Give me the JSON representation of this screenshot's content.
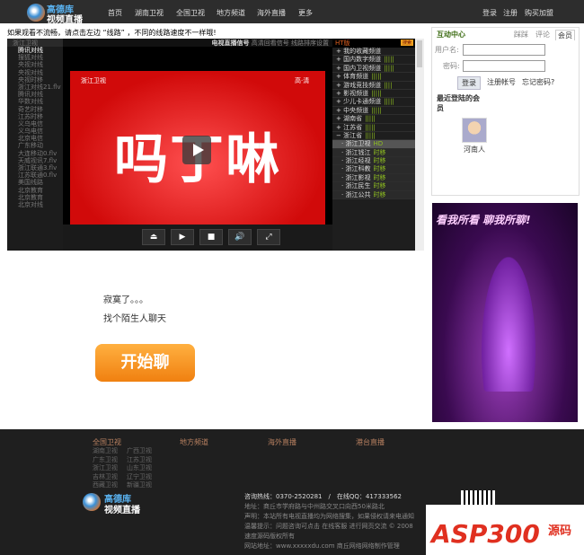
{
  "header": {
    "logo_line1": "高德库",
    "logo_line2": "视频直播",
    "nav": [
      "首页",
      "湖南卫视",
      "全国卫视",
      "地方频道",
      "海外直播",
      "更多"
    ],
    "user_links": [
      "登录",
      "注册",
      "购买加盟"
    ]
  },
  "notice": "如果观看不流畅，请点击左边 “线路” ，不同的线路速度不一样哦!",
  "player": {
    "left_head": "浙江卫视",
    "lines": [
      "腾讯对线",
      "搜狐对线",
      "央视对线",
      "央视对线",
      "央视时移",
      "浙江对线21.flv",
      "腾讯对线",
      "华数对线",
      "奇艺时移",
      "江苏时移",
      "义乌电信",
      "义乌电信",
      "北京电信",
      "广东移动",
      "大连移动0.flv",
      "天威视讯7.flv",
      "浙江联通3.flv",
      "江苏联通0.flv",
      "美国线路",
      "北京教育",
      "北京教育",
      "北京对线"
    ],
    "topbar_bold": "电视直播信号",
    "topbar_links": "高清回看信号 线路排序设置",
    "video_text": "吗丁啉",
    "channel_logo": "浙江卫视",
    "hd_mark": "高·清",
    "controls": [
      "⏏",
      "▶",
      "■",
      "🔊",
      "⤢"
    ],
    "list_title": "HT版",
    "search": "搜索",
    "groups": [
      {
        "n": "我的收藏频道",
        "m": ""
      },
      {
        "n": "国内数字频道",
        "m": "|||||"
      },
      {
        "n": "国内卫视频道",
        "m": "|||||"
      },
      {
        "n": "体育频道",
        "m": "|||||"
      },
      {
        "n": "游戏竞技频道",
        "m": "||||"
      },
      {
        "n": "影视频道",
        "m": "|||||"
      },
      {
        "n": "少儿卡通频道",
        "m": "|||||"
      },
      {
        "n": "中央频道",
        "m": "|||||"
      },
      {
        "n": "湖南省",
        "m": "|||||"
      },
      {
        "n": "江苏省",
        "m": "|||||"
      },
      {
        "n": "浙江省",
        "m": "|||||"
      }
    ],
    "channels": [
      {
        "n": "浙江卫视",
        "m": "HD"
      },
      {
        "n": "浙江钱江",
        "m": "时移"
      },
      {
        "n": "浙江经视",
        "m": "时移"
      },
      {
        "n": "浙江科教",
        "m": "时移"
      },
      {
        "n": "浙江影视",
        "m": "时移"
      },
      {
        "n": "浙江民生",
        "m": "时移"
      },
      {
        "n": "浙江公共",
        "m": "时移"
      }
    ]
  },
  "chat": {
    "line1": "寂寞了。。。",
    "line2": "找个陌生人聊天",
    "button": "开始聊"
  },
  "side": {
    "title": "互动中心",
    "tabs": [
      "踩踩",
      "评论",
      "会员"
    ],
    "username_label": "用户名:",
    "password_label": "密码:",
    "login": "登录",
    "register": "注册帐号",
    "forgot": "忘记密码?",
    "recent": "最近登陆的会员",
    "member": "河南人"
  },
  "ad": {
    "text": "看我所看 聊我所聊!"
  },
  "footer": {
    "cols": [
      "全国卫视",
      "地方频道",
      "海外直播",
      "港台直播"
    ],
    "links": [
      "湖南卫视",
      "广西卫视",
      "广东卫视",
      "江苏卫视",
      "浙江卫视",
      "山东卫视",
      "吉林卫视",
      "辽宁卫视",
      "西藏卫视",
      "新疆卫视"
    ],
    "hotline": "咨询热线：0370-2520281　/　在线QQ：417333562",
    "address": "地址：商丘市学府路与中州路交叉口向西50米路北",
    "statement": "声明：本站所有电视直播均为网络搜集，如果侵权请来电通知",
    "tip": "温馨提示：问题咨询可点击 在线客服 进行网页交流 © 2008",
    "copyright": "速度源码版权所有",
    "site": "网站地址：www.xxxxxdu.com 商丘网络网络制作管理"
  },
  "watermark": {
    "text": "ASP300",
    "sub": "源码"
  }
}
